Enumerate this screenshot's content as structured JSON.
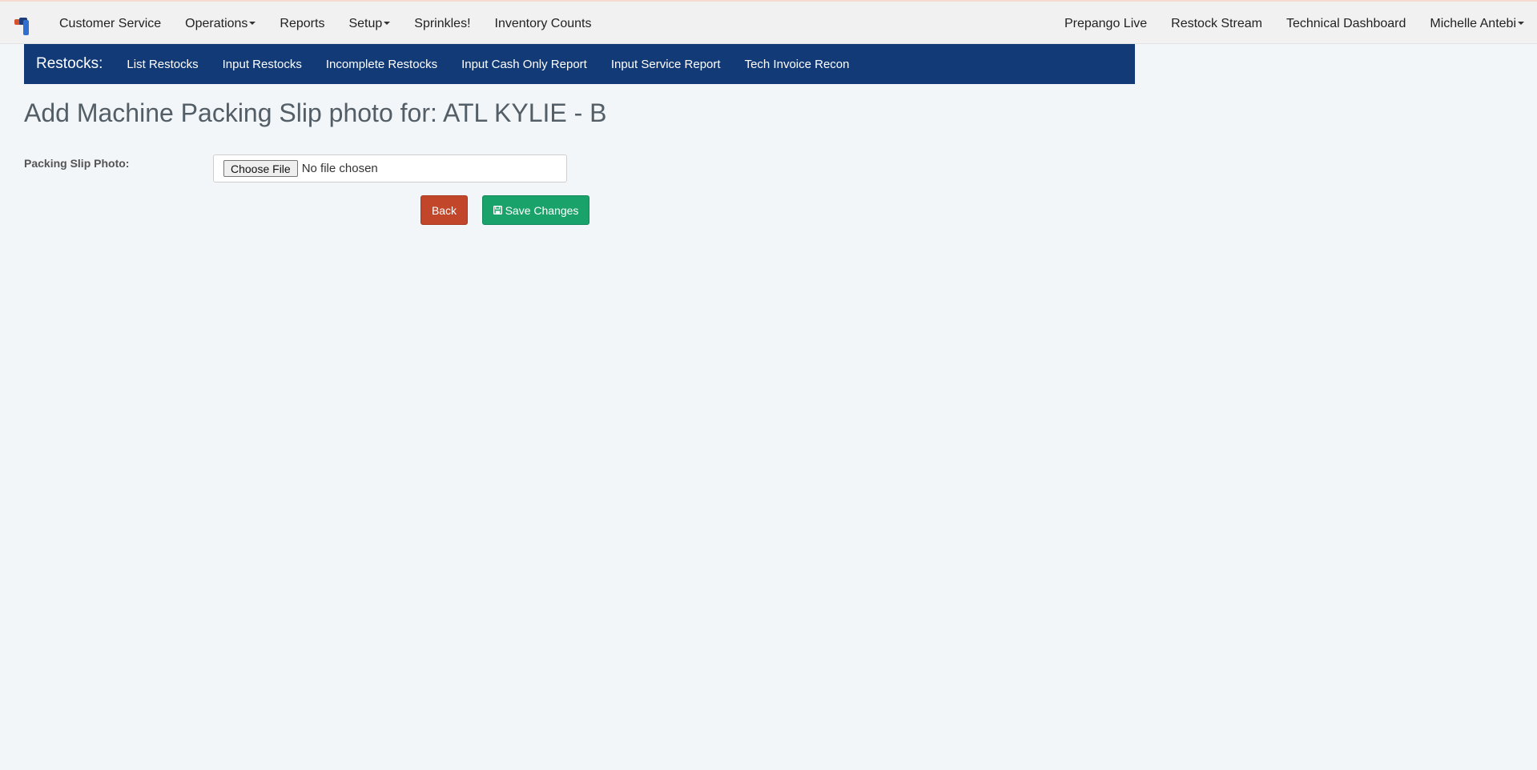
{
  "topnav": {
    "left_items": [
      {
        "label": "Customer Service",
        "dropdown": false
      },
      {
        "label": "Operations",
        "dropdown": true
      },
      {
        "label": "Reports",
        "dropdown": false
      },
      {
        "label": "Setup",
        "dropdown": true
      },
      {
        "label": "Sprinkles!",
        "dropdown": false
      },
      {
        "label": "Inventory Counts",
        "dropdown": false
      }
    ],
    "right_items": [
      {
        "label": "Prepango Live",
        "dropdown": false
      },
      {
        "label": "Restock Stream",
        "dropdown": false
      },
      {
        "label": "Technical Dashboard",
        "dropdown": false
      },
      {
        "label": "Michelle Antebi",
        "dropdown": true
      }
    ]
  },
  "subnav": {
    "brand": "Restocks:",
    "items": [
      "List Restocks",
      "Input Restocks",
      "Incomplete Restocks",
      "Input Cash Only Report",
      "Input Service Report",
      "Tech Invoice Recon"
    ]
  },
  "page": {
    "title": "Add Machine Packing Slip photo for: ATL KYLIE - B"
  },
  "form": {
    "photo_label": "Packing Slip Photo:",
    "choose_file_label": "Choose File",
    "file_status": "No file chosen",
    "back_label": "Back",
    "save_label": "Save Changes"
  },
  "colors": {
    "subnav_bg": "#123a77",
    "back_button": "#c2472a",
    "save_button": "#19a36a",
    "page_bg": "#f2f6f9"
  },
  "icons": {
    "logo": "app-logo",
    "save": "floppy-disk-icon",
    "dropdown": "caret-down-icon"
  }
}
